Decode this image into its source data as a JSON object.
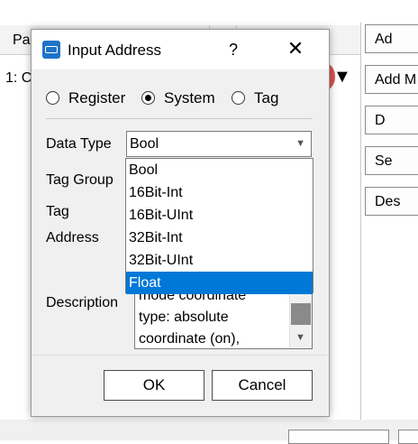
{
  "background": {
    "column_header": "Pa",
    "row_text": "1: C",
    "side_buttons": [
      "Ad",
      "Add M",
      "D",
      "Se",
      "Des"
    ]
  },
  "dialog": {
    "title": "Input Address",
    "help_label": "?",
    "close_label": "✕",
    "address_types": [
      {
        "label": "Register",
        "selected": false
      },
      {
        "label": "System",
        "selected": true
      },
      {
        "label": "Tag",
        "selected": false
      }
    ],
    "fields": {
      "data_type_label": "Data Type",
      "tag_group_label": "Tag Group",
      "tag_label": "Tag",
      "address_label": "Address",
      "description_label": "Description"
    },
    "data_type_value": "Bool",
    "data_type_options": [
      "Bool",
      "16Bit-Int",
      "16Bit-UInt",
      "32Bit-Int",
      "32Bit-UInt",
      "Float"
    ],
    "highlighted_option": "Float",
    "description_lines": [
      "mode coordinate",
      "type: absolute",
      "coordinate (on),"
    ],
    "ok_label": "OK",
    "cancel_label": "Cancel"
  }
}
